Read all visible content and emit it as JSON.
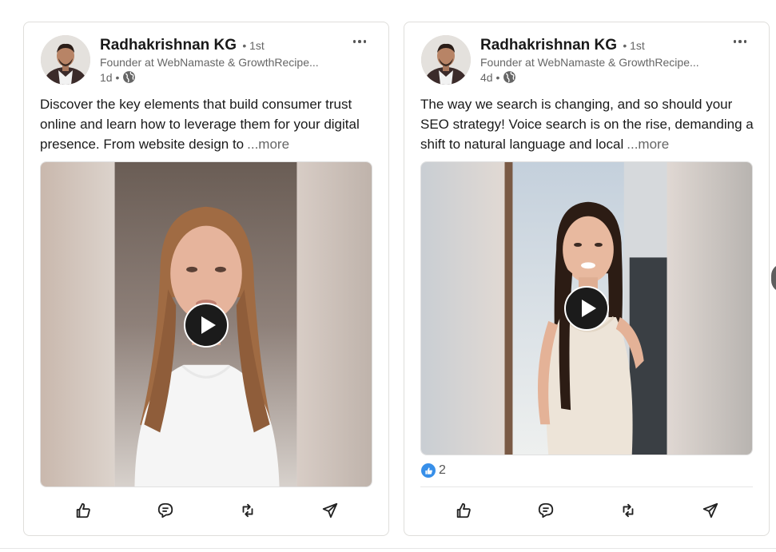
{
  "posts": [
    {
      "author": {
        "name": "Radhakrishnan KG",
        "degree": "• 1st",
        "headline": "Founder at WebNamaste & GrowthRecipe...",
        "time": "1d •"
      },
      "text": "Discover the key elements that build consumer trust online and learn how to leverage them for your digital presence. From website design to",
      "more_label": "...more",
      "reactions": null
    },
    {
      "author": {
        "name": "Radhakrishnan KG",
        "degree": "• 1st",
        "headline": "Founder at WebNamaste & GrowthRecipe...",
        "time": "4d •"
      },
      "text": "The way we search is changing, and so should your SEO strategy! Voice search is on the rise, demanding a shift to natural language and local",
      "more_label": "...more",
      "reactions": {
        "count": "2"
      }
    }
  ],
  "icons": {
    "menu": "ellipsis-icon",
    "visibility": "globe-icon",
    "play": "play-icon",
    "like": "thumbs-up-icon",
    "comment": "comment-icon",
    "repost": "repost-icon",
    "send": "send-icon"
  },
  "colors": {
    "reaction_blue": "#378fe9",
    "text_secondary": "#666666"
  }
}
